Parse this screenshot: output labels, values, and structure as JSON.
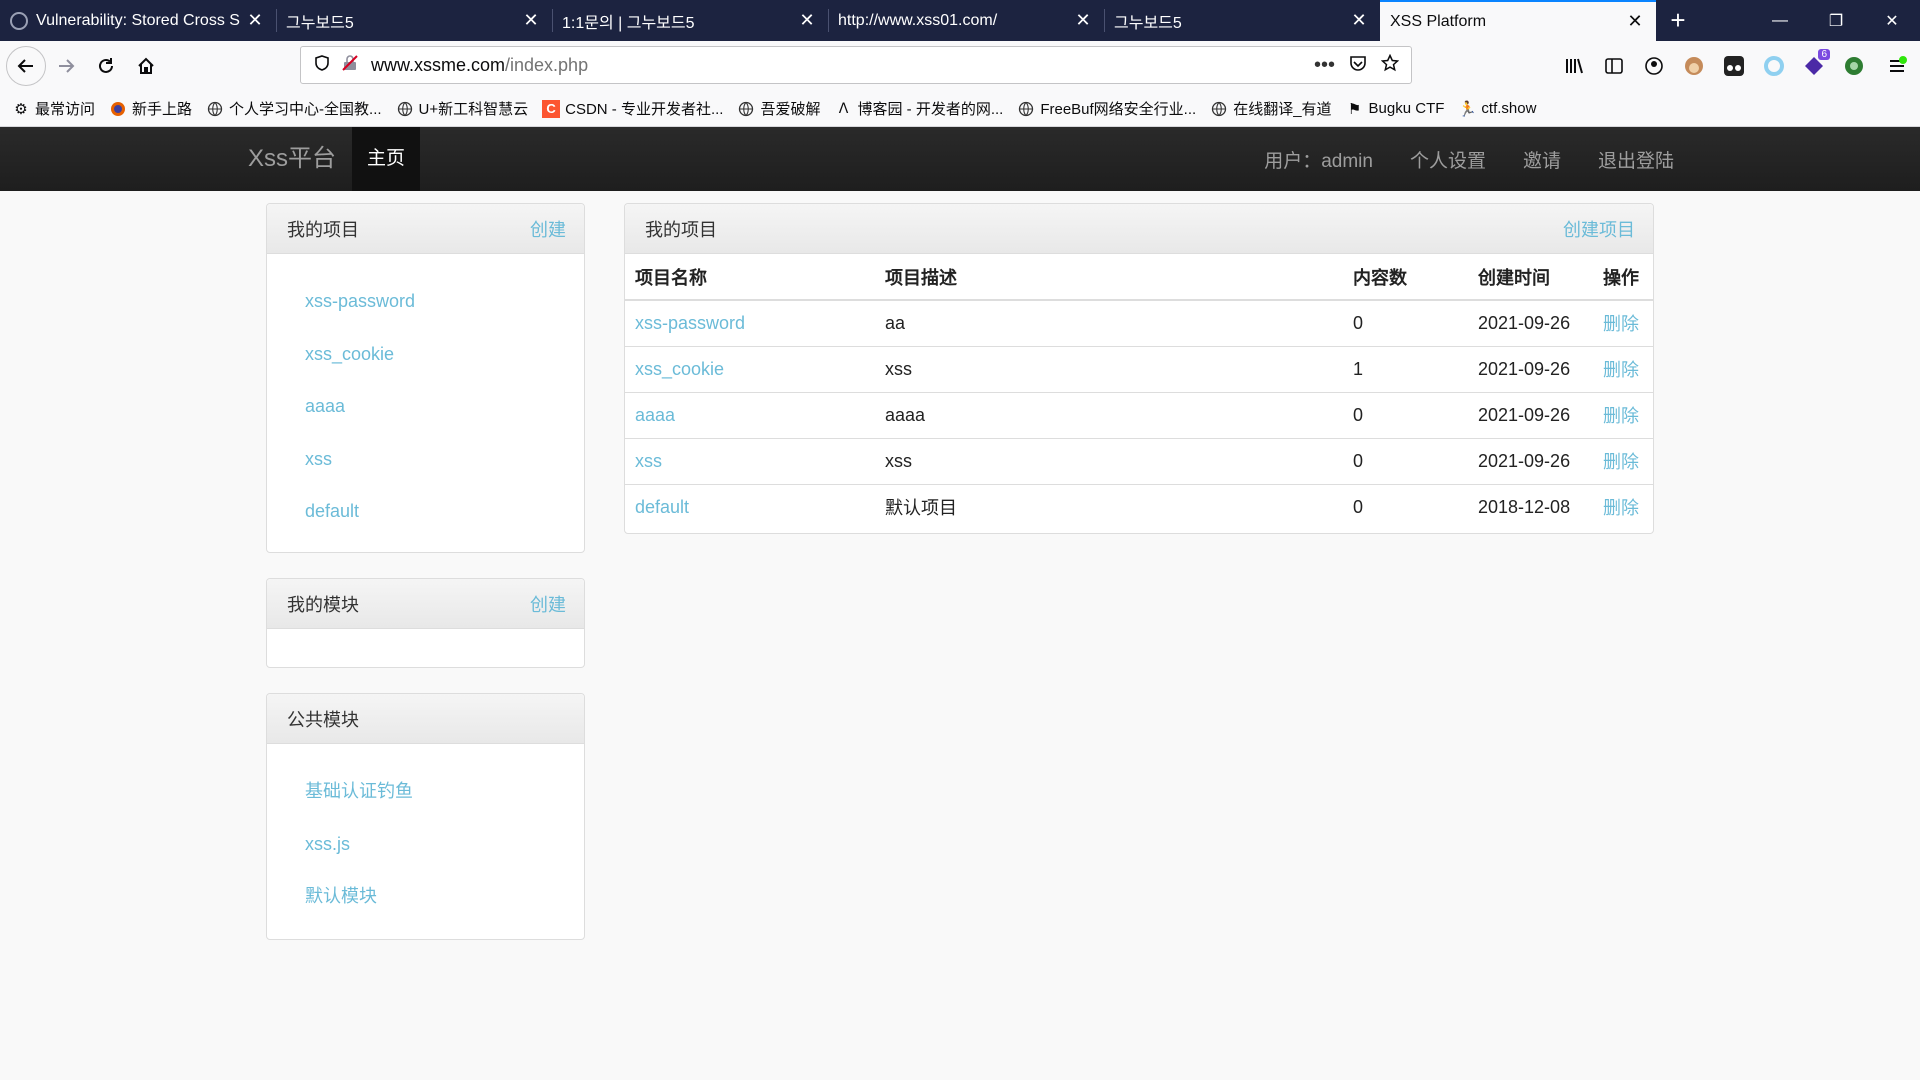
{
  "browser": {
    "tabs": [
      {
        "title": "Vulnerability: Stored Cross S",
        "active": false
      },
      {
        "title": "그누보드5",
        "active": false
      },
      {
        "title": "1:1문의 | 그누보드5",
        "active": false
      },
      {
        "title": "http://www.xss01.com/",
        "active": false
      },
      {
        "title": "그누보드5",
        "active": false
      },
      {
        "title": "XSS Platform",
        "active": true
      }
    ],
    "url_domain": "www.xssme.com",
    "url_path": "/index.php",
    "extension_badge": "6",
    "bookmarks": [
      {
        "label": "最常访问",
        "icon": "gear-icon"
      },
      {
        "label": "新手上路",
        "icon": "firefox-icon"
      },
      {
        "label": "个人学习中心-全国教...",
        "icon": "globe-icon"
      },
      {
        "label": "U+新工科智慧云",
        "icon": "globe-icon"
      },
      {
        "label": "CSDN - 专业开发者社...",
        "icon": "csdn-icon"
      },
      {
        "label": "吾爱破解",
        "icon": "globe-icon"
      },
      {
        "label": "博客园 - 开发者的网...",
        "icon": "cnblogs-icon"
      },
      {
        "label": "FreeBuf网络安全行业...",
        "icon": "globe-icon"
      },
      {
        "label": "在线翻译_有道",
        "icon": "globe-icon"
      },
      {
        "label": "Bugku CTF",
        "icon": "flag-icon"
      },
      {
        "label": "ctf.show",
        "icon": "runner-icon"
      }
    ]
  },
  "site": {
    "brand": "Xss平台",
    "nav_home": "主页",
    "user_label": "用户：admin",
    "settings": "个人设置",
    "invite": "邀请",
    "logout": "退出登陆"
  },
  "sidebar": {
    "projects": {
      "title": "我的项目",
      "create": "创建",
      "items": [
        "xss-password",
        "xss_cookie",
        "aaaa",
        "xss",
        "default"
      ]
    },
    "modules": {
      "title": "我的模块",
      "create": "创建",
      "items": []
    },
    "public_modules": {
      "title": "公共模块",
      "items": [
        "基础认证钓鱼",
        "xss.js",
        "默认模块"
      ]
    }
  },
  "main": {
    "title": "我的项目",
    "create_project": "创建项目",
    "columns": [
      "项目名称",
      "项目描述",
      "内容数",
      "创建时间",
      "操作"
    ],
    "rows": [
      {
        "name": "xss-password",
        "desc": "aa",
        "count": "0",
        "date": "2021-09-26",
        "action": "删除"
      },
      {
        "name": "xss_cookie",
        "desc": "xss",
        "count": "1",
        "date": "2021-09-26",
        "action": "删除"
      },
      {
        "name": "aaaa",
        "desc": "aaaa",
        "count": "0",
        "date": "2021-09-26",
        "action": "删除"
      },
      {
        "name": "xss",
        "desc": "xss",
        "count": "0",
        "date": "2021-09-26",
        "action": "删除"
      },
      {
        "name": "default",
        "desc": "默认项目",
        "count": "0",
        "date": "2018-12-08",
        "action": "删除"
      }
    ]
  }
}
